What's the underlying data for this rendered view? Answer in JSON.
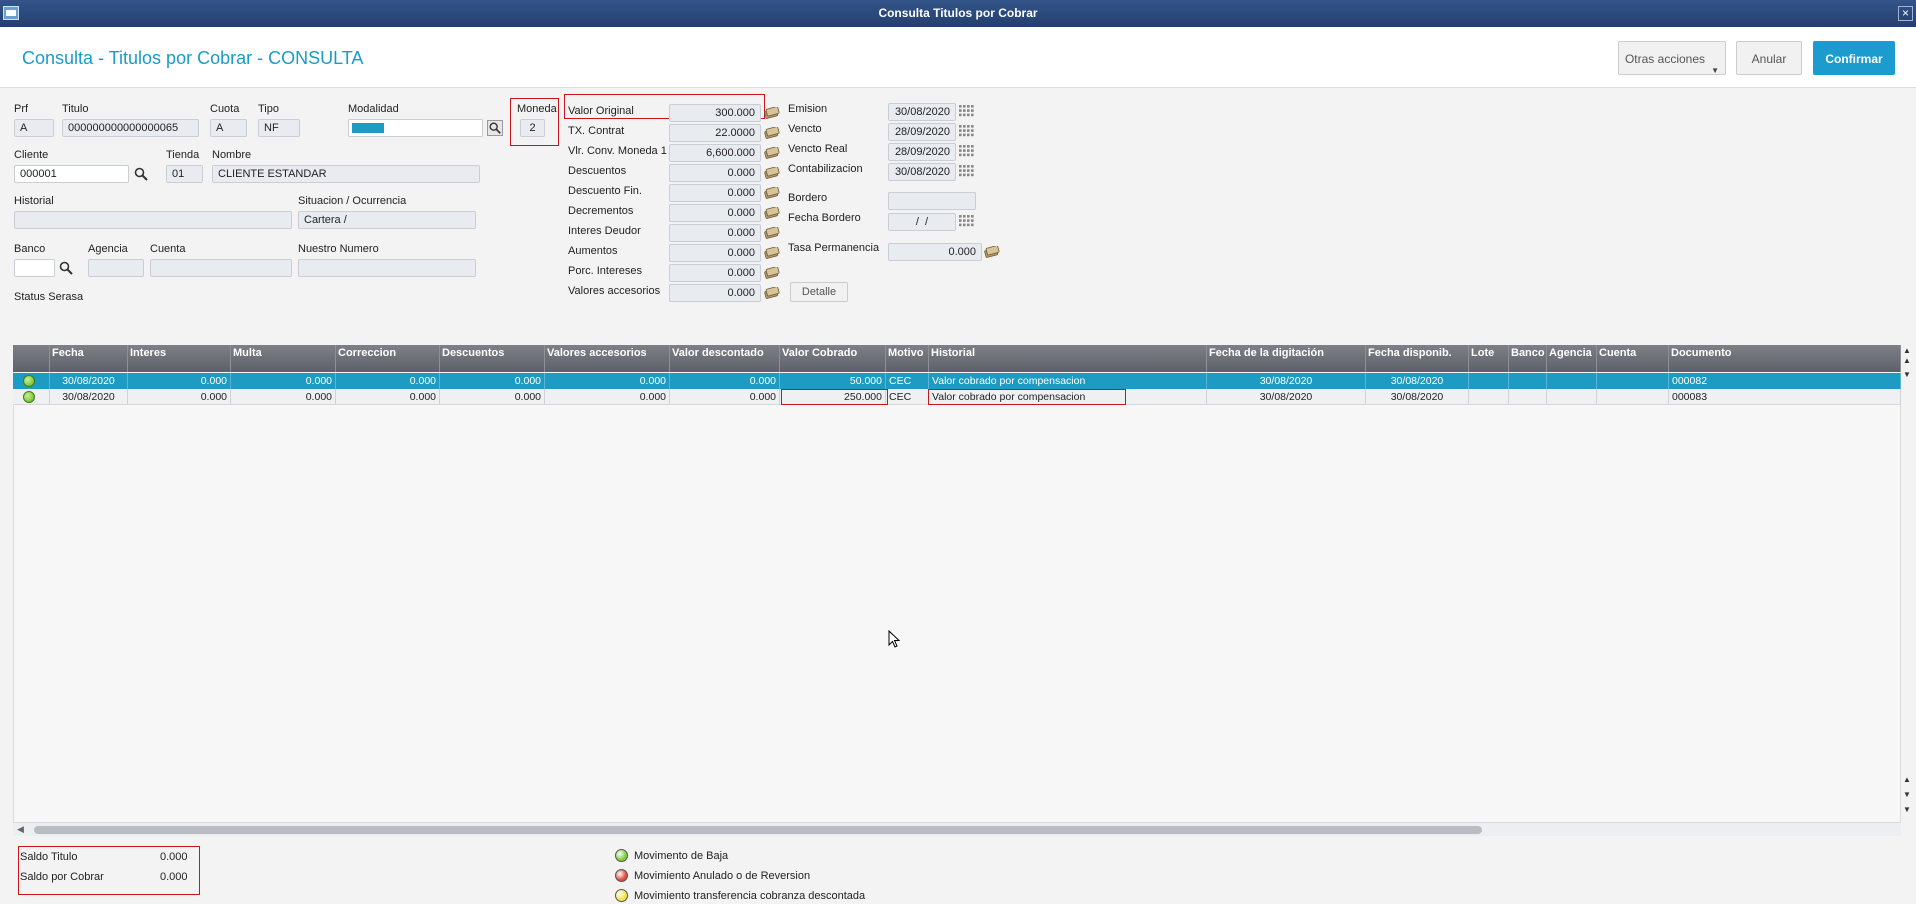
{
  "window": {
    "title": "Consulta Titulos por Cobrar"
  },
  "page": {
    "title": "Consulta - Titulos por Cobrar - CONSULTA"
  },
  "toolbar": {
    "otras_acciones": "Otras acciones",
    "anular": "Anular",
    "confirmar": "Confirmar"
  },
  "form": {
    "prf": {
      "label": "Prf",
      "value": "A"
    },
    "titulo": {
      "label": "Titulo",
      "value": "000000000000000065"
    },
    "cuota": {
      "label": "Cuota",
      "value": "A"
    },
    "tipo": {
      "label": "Tipo",
      "value": "NF"
    },
    "modalidad": {
      "label": "Modalidad",
      "value": ""
    },
    "moneda": {
      "label": "Moneda",
      "value": "2"
    },
    "cliente": {
      "label": "Cliente",
      "value": "000001"
    },
    "tienda": {
      "label": "Tienda",
      "value": "01"
    },
    "nombre": {
      "label": "Nombre",
      "value": "CLIENTE ESTANDAR"
    },
    "historial": {
      "label": "Historial",
      "value": ""
    },
    "situacion": {
      "label": "Situacion / Ocurrencia",
      "value": "Cartera /"
    },
    "banco": {
      "label": "Banco",
      "value": ""
    },
    "agencia": {
      "label": "Agencia",
      "value": ""
    },
    "cuenta": {
      "label": "Cuenta",
      "value": ""
    },
    "nuestro_numero": {
      "label": "Nuestro Numero",
      "value": ""
    },
    "status_serasa": {
      "label": "Status Serasa"
    }
  },
  "values": [
    {
      "label": "Valor Original",
      "value": "300.000"
    },
    {
      "label": "TX. Contrat",
      "value": "22.0000"
    },
    {
      "label": "Vlr. Conv. Moneda 1",
      "value": "6,600.000"
    },
    {
      "label": "Descuentos",
      "value": "0.000"
    },
    {
      "label": "Descuento Fin.",
      "value": "0.000"
    },
    {
      "label": "Decrementos",
      "value": "0.000"
    },
    {
      "label": "Interes Deudor",
      "value": "0.000"
    },
    {
      "label": "Aumentos",
      "value": "0.000"
    },
    {
      "label": "Porc. Intereses",
      "value": "0.000"
    },
    {
      "label": "Valores accesorios",
      "value": "0.000"
    }
  ],
  "detalle_label": "Detalle",
  "dates": {
    "emision": {
      "label": "Emision",
      "value": "30/08/2020"
    },
    "vencto": {
      "label": "Vencto",
      "value": "28/09/2020"
    },
    "vencto_real": {
      "label": "Vencto Real",
      "value": "28/09/2020"
    },
    "contabilizacion": {
      "label": "Contabilizacion",
      "value": "30/08/2020"
    },
    "bordero": {
      "label": "Bordero",
      "value": ""
    },
    "fecha_bordero": {
      "label": "Fecha Bordero",
      "value": " /  / "
    },
    "tasa_permanencia": {
      "label": "Tasa Permanencia",
      "value": "0.000"
    }
  },
  "grid": {
    "columns": [
      "",
      "Fecha",
      "Interes",
      "Multa",
      "Correccion",
      "Descuentos",
      "Valores accesorios",
      "Valor descontado",
      "Valor Cobrado",
      "Motivo",
      "Historial",
      "Fecha de la digitación",
      "Fecha disponib.",
      "Lote",
      "Banco",
      "Agencia",
      "Cuenta",
      "Documento"
    ],
    "rows": [
      [
        "",
        "30/08/2020",
        "0.000",
        "0.000",
        "0.000",
        "0.000",
        "0.000",
        "0.000",
        "50.000",
        "CEC",
        "Valor cobrado por compensacion",
        "30/08/2020",
        "30/08/2020",
        "",
        "",
        "",
        "",
        "000082"
      ],
      [
        "",
        "30/08/2020",
        "0.000",
        "0.000",
        "0.000",
        "0.000",
        "0.000",
        "0.000",
        "250.000",
        "CEC",
        "Valor cobrado por compensacion",
        "30/08/2020",
        "30/08/2020",
        "",
        "",
        "",
        "",
        "000083"
      ]
    ]
  },
  "totals": {
    "saldo_titulo": {
      "label": "Saldo Titulo",
      "value": "0.000"
    },
    "saldo_por_cobrar": {
      "label": "Saldo por Cobrar",
      "value": "0.000"
    }
  },
  "legend": [
    {
      "label": "Movimento de Baja",
      "color": "#7ccf3a"
    },
    {
      "label": "Movimiento Anulado o de Reversion",
      "color": "#e04a3a"
    },
    {
      "label": "Movimiento transferencia cobranza descontada",
      "color": "#f2e24a"
    }
  ],
  "colors": {
    "accent": "#1b9bce",
    "highlight": "#c7161d",
    "selected_row": "#1e9bc2"
  }
}
